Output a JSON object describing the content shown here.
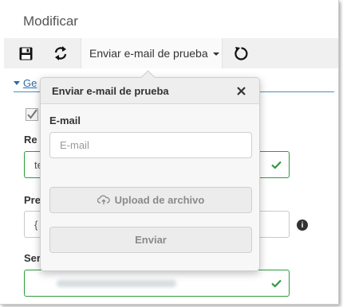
{
  "window": {
    "title": "Modificar"
  },
  "toolbar": {
    "send_test_label": "Enviar e-mail de prueba",
    "save_icon": "save-icon",
    "sync_icon": "sync-icon",
    "undo_icon": "undo-icon"
  },
  "section": {
    "label": "Ge"
  },
  "form": {
    "field1_label": "Re",
    "field1_value": "te",
    "field2_label": "Pre",
    "field2_value": "{",
    "field3_label": "Ser"
  },
  "popover": {
    "title": "Enviar e-mail de prueba",
    "email_label": "E-mail",
    "email_placeholder": "E-mail",
    "email_value": "",
    "upload_label": "Upload de archivo",
    "send_label": "Enviar"
  },
  "colors": {
    "valid_border": "#2e9a3a",
    "link_blue": "#2a6ca8",
    "toolbar_bg": "#f0f0f0"
  }
}
